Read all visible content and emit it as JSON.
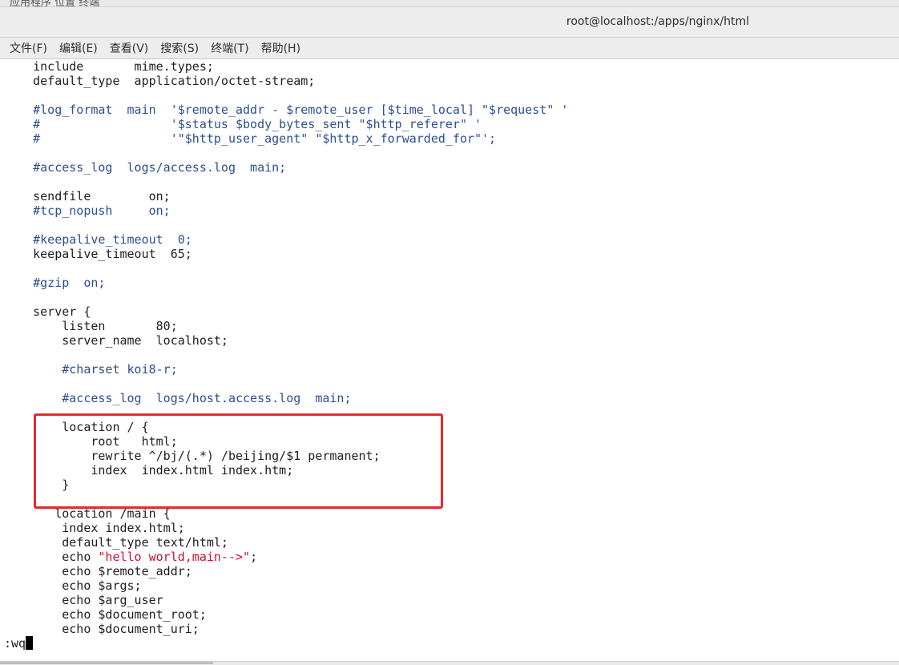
{
  "top_panel": {
    "text": "应用程序  位置  终端"
  },
  "window": {
    "title": "root@localhost:/apps/nginx/html"
  },
  "menu": [
    "文件(F)",
    "编辑(E)",
    "查看(V)",
    "搜索(S)",
    "终端(T)",
    "帮助(H)"
  ],
  "lines": [
    "    include       mime.types;",
    "    default_type  application/octet-stream;",
    "",
    "    #log_format  main  '$remote_addr - $remote_user [$time_local] \"$request\" '",
    "    #                  '$status $body_bytes_sent \"$http_referer\" '",
    "    #                  '\"$http_user_agent\" \"$http_x_forwarded_for\"';",
    "",
    "    #access_log  logs/access.log  main;",
    "",
    "    sendfile        on;",
    "    #tcp_nopush     on;",
    "",
    "    #keepalive_timeout  0;",
    "    keepalive_timeout  65;",
    "",
    "    #gzip  on;",
    "",
    "    server {",
    "        listen       80;",
    "        server_name  localhost;",
    "",
    "        #charset koi8-r;",
    "",
    "        #access_log  logs/host.access.log  main;",
    "",
    "        location / {",
    "            root   html;",
    "            rewrite ^/bj/(.*) /beijing/$1 permanent;",
    "            index  index.html index.htm;",
    "        }",
    "",
    "       location /main {",
    "        index index.html;",
    "        default_type text/html;",
    "        echo ",
    "        echo $remote_addr;",
    "        echo $args;",
    "        echo $arg_user",
    "        echo $document_root;",
    "        echo $document_uri;"
  ],
  "echo_string": "\"hello world,main-->\"",
  "echo_suffix": ";",
  "command_line": ":wq"
}
